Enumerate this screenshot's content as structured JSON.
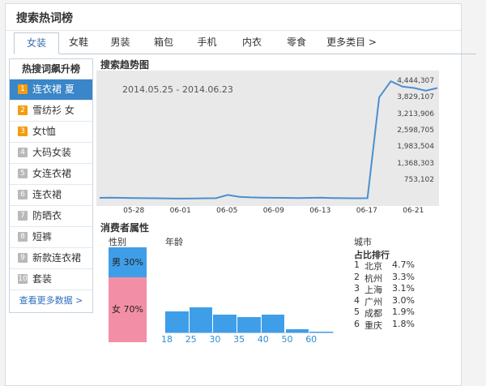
{
  "panel_title": "搜索热词榜",
  "tabs": [
    "女装",
    "女鞋",
    "男装",
    "箱包",
    "手机",
    "内衣",
    "零食",
    "更多类目 >"
  ],
  "sidebar": {
    "title": "热搜词飙升榜",
    "items": [
      {
        "rank": "1",
        "label": "连衣裙 夏"
      },
      {
        "rank": "2",
        "label": "雪纺衫 女"
      },
      {
        "rank": "3",
        "label": "女t恤"
      },
      {
        "rank": "4",
        "label": "大码女装"
      },
      {
        "rank": "5",
        "label": "女连衣裙"
      },
      {
        "rank": "6",
        "label": "连衣裙"
      },
      {
        "rank": "7",
        "label": "防晒衣"
      },
      {
        "rank": "8",
        "label": "短裤"
      },
      {
        "rank": "9",
        "label": "新款连衣裙"
      },
      {
        "rank": "10",
        "label": "套装"
      }
    ],
    "more": "查看更多数据 >"
  },
  "trend": {
    "title": "搜索趋势图",
    "date_range": "2014.05.25 - 2014.06.23"
  },
  "chart_data": {
    "type": "line",
    "title": "搜索趋势图",
    "x_ticks": [
      "05-28",
      "06-01",
      "06-05",
      "06-09",
      "06-13",
      "06-17",
      "06-21"
    ],
    "y_ticks": [
      4444307,
      3829107,
      3213906,
      2598705,
      1983504,
      1368303,
      753102
    ],
    "y_tick_labels": [
      "4,444,307",
      "3,829,107",
      "3,213,906",
      "2,598,705",
      "1,983,504",
      "1,368,303",
      "753,102"
    ],
    "x": [
      "05-25",
      "05-26",
      "05-27",
      "05-28",
      "05-29",
      "05-30",
      "05-31",
      "06-01",
      "06-02",
      "06-03",
      "06-04",
      "06-05",
      "06-06",
      "06-07",
      "06-08",
      "06-09",
      "06-10",
      "06-11",
      "06-12",
      "06-13",
      "06-14",
      "06-15",
      "06-16",
      "06-17",
      "06-18",
      "06-19",
      "06-20",
      "06-21",
      "06-22",
      "06-23"
    ],
    "values": [
      150000,
      160000,
      150000,
      145000,
      140000,
      135000,
      130000,
      125000,
      130000,
      135000,
      140000,
      260000,
      190000,
      170000,
      160000,
      155000,
      150000,
      145000,
      150000,
      160000,
      145000,
      140000,
      135000,
      140000,
      3900000,
      4500000,
      4300000,
      4250000,
      4150000,
      4250000
    ],
    "ylim": [
      0,
      4900000
    ]
  },
  "consumer": {
    "title": "消费者属性",
    "gender_label": "性别",
    "male": "男 30%",
    "female": "女 70%",
    "age_label": "年龄",
    "age_ticks": [
      "18",
      "25",
      "30",
      "35",
      "40",
      "50",
      "60"
    ],
    "age_values": [
      0.44,
      0.51,
      0.37,
      0.31,
      0.36,
      0.06,
      0.02
    ],
    "city_label": "城市",
    "city_subtitle": "占比排行",
    "cities": [
      {
        "rank": "1",
        "name": "北京",
        "pct": "4.7%"
      },
      {
        "rank": "2",
        "name": "杭州",
        "pct": "3.3%"
      },
      {
        "rank": "3",
        "name": "上海",
        "pct": "3.1%"
      },
      {
        "rank": "4",
        "name": "广州",
        "pct": "3.0%"
      },
      {
        "rank": "5",
        "name": "成都",
        "pct": "1.9%"
      },
      {
        "rank": "6",
        "name": "重庆",
        "pct": "1.8%"
      }
    ]
  },
  "colors": {
    "accent": "#3a86c8",
    "male": "#3f9ee8",
    "female": "#f28fa6",
    "hot_rank": "#f39c12",
    "line": "#4a8fd0"
  }
}
